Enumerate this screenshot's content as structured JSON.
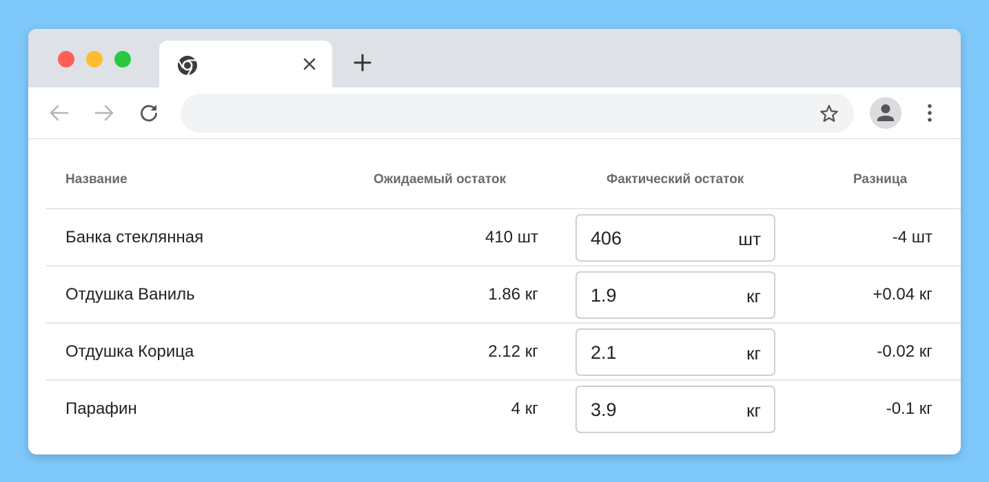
{
  "browser": {
    "tab": {
      "title": ""
    },
    "address_bar": {
      "value": ""
    }
  },
  "table": {
    "headers": {
      "name": "Название",
      "expected": "Ожидаемый остаток",
      "actual": "Фактический остаток",
      "difference": "Разница"
    },
    "rows": [
      {
        "name": "Банка стеклянная",
        "expected": "410 шт",
        "actual_value": "406",
        "actual_unit": "шт",
        "difference": "-4 шт"
      },
      {
        "name": "Отдушка Ваниль",
        "expected": "1.86 кг",
        "actual_value": "1.9",
        "actual_unit": "кг",
        "difference": "+0.04 кг"
      },
      {
        "name": "Отдушка Корица",
        "expected": "2.12 кг",
        "actual_value": "2.1",
        "actual_unit": "кг",
        "difference": "-0.02 кг"
      },
      {
        "name": "Парафин",
        "expected": "4 кг",
        "actual_value": "3.9",
        "actual_unit": "кг",
        "difference": "-0.1 кг"
      }
    ]
  },
  "colors": {
    "page_background": "#7ec8fb",
    "tabstrip": "#dee1e6",
    "traffic_red": "#fe5f58",
    "traffic_yellow": "#febc2e",
    "traffic_green": "#29c840"
  }
}
